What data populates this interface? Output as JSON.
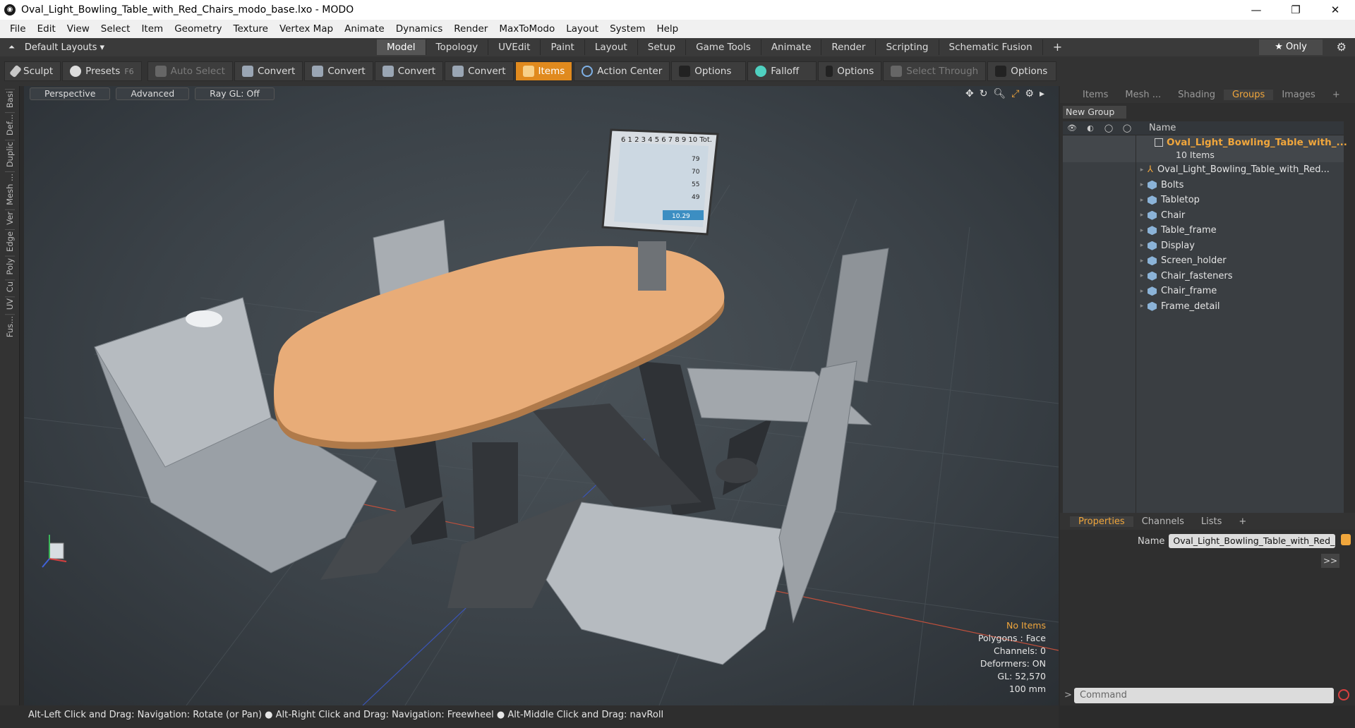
{
  "window": {
    "title": "Oval_Light_Bowling_Table_with_Red_Chairs_modo_base.lxo - MODO",
    "controls": [
      "—",
      "❐",
      "✕"
    ]
  },
  "menu": [
    "File",
    "Edit",
    "View",
    "Select",
    "Item",
    "Geometry",
    "Texture",
    "Vertex Map",
    "Animate",
    "Dynamics",
    "Render",
    "MaxToModo",
    "Layout",
    "System",
    "Help"
  ],
  "layout_bar": {
    "layouts_label": "Default Layouts ▾",
    "tabs": [
      "Model",
      "Topology",
      "UVEdit",
      "Paint",
      "Layout",
      "Setup",
      "Game Tools",
      "Animate",
      "Render",
      "Scripting",
      "Schematic Fusion",
      "+"
    ],
    "only_label": "★ Only"
  },
  "toolbar": {
    "sculpt": "Sculpt",
    "presets": "Presets",
    "presets_key": "F6",
    "auto_select": "Auto Select",
    "convert": "Convert",
    "items": "Items",
    "action_center": "Action Center",
    "options": "Options",
    "falloff": "Falloff",
    "select_through": "Select Through"
  },
  "left_strip": [
    "Basi",
    "Def...",
    "Duplic",
    "Mesh ...",
    "Ver",
    "Edge",
    "Poly",
    "Cu",
    "UV",
    "Fus..."
  ],
  "viewport": {
    "view_mode": "Perspective",
    "advanced": "Advanced",
    "raygl": "Ray GL: Off",
    "stats": {
      "selection": "No Items",
      "polygons": "Polygons : Face",
      "channels": "Channels: 0",
      "deformers": "Deformers: ON",
      "gl": "GL: 52,570",
      "scale": "100 mm"
    },
    "scoreboard": {
      "header": "6 1 2 3 4 5 6 7 8 9 10 Tot.",
      "scores": [
        "79",
        "70",
        "55",
        "49"
      ],
      "final": "10.29"
    }
  },
  "status": "Alt-Left Click and Drag: Navigation: Rotate (or Pan) ● Alt-Right Click and Drag: Navigation: Freewheel ● Alt-Middle Click and Drag: navRoll",
  "right_panel": {
    "tabs": [
      "Items",
      "Mesh ...",
      "Shading",
      "Groups",
      "Images",
      "+"
    ],
    "new_group": "New Group",
    "name_col": "Name",
    "group": {
      "name": "Oval_Light_Bowling_Table_with_...",
      "count": "10 Items"
    },
    "children": [
      "Oval_Light_Bowling_Table_with_Red...",
      "Bolts",
      "Tabletop",
      "Chair",
      "Table_frame",
      "Display",
      "Screen_holder",
      "Chair_fasteners",
      "Chair_frame",
      "Frame_detail"
    ]
  },
  "properties": {
    "tabs": [
      "Properties",
      "Channels",
      "Lists",
      "+"
    ],
    "name_label": "Name",
    "name_value": "Oval_Light_Bowling_Table_with_Red_C",
    "expand": ">>",
    "command_placeholder": "Command"
  }
}
